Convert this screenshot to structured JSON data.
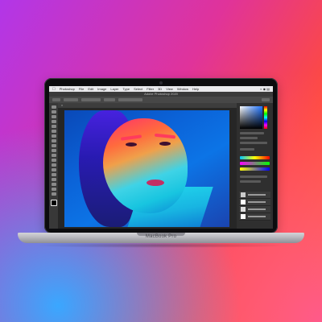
{
  "menubar": {
    "app_name": "Photoshop",
    "items": [
      "File",
      "Edit",
      "Image",
      "Layer",
      "Type",
      "Select",
      "Filter",
      "3D",
      "View",
      "Window",
      "Help"
    ]
  },
  "window_title": "Adobe Photoshop 2020",
  "laptop": {
    "brand": "MacBook Pro"
  },
  "colors": {
    "accent": "#1e73ff"
  }
}
